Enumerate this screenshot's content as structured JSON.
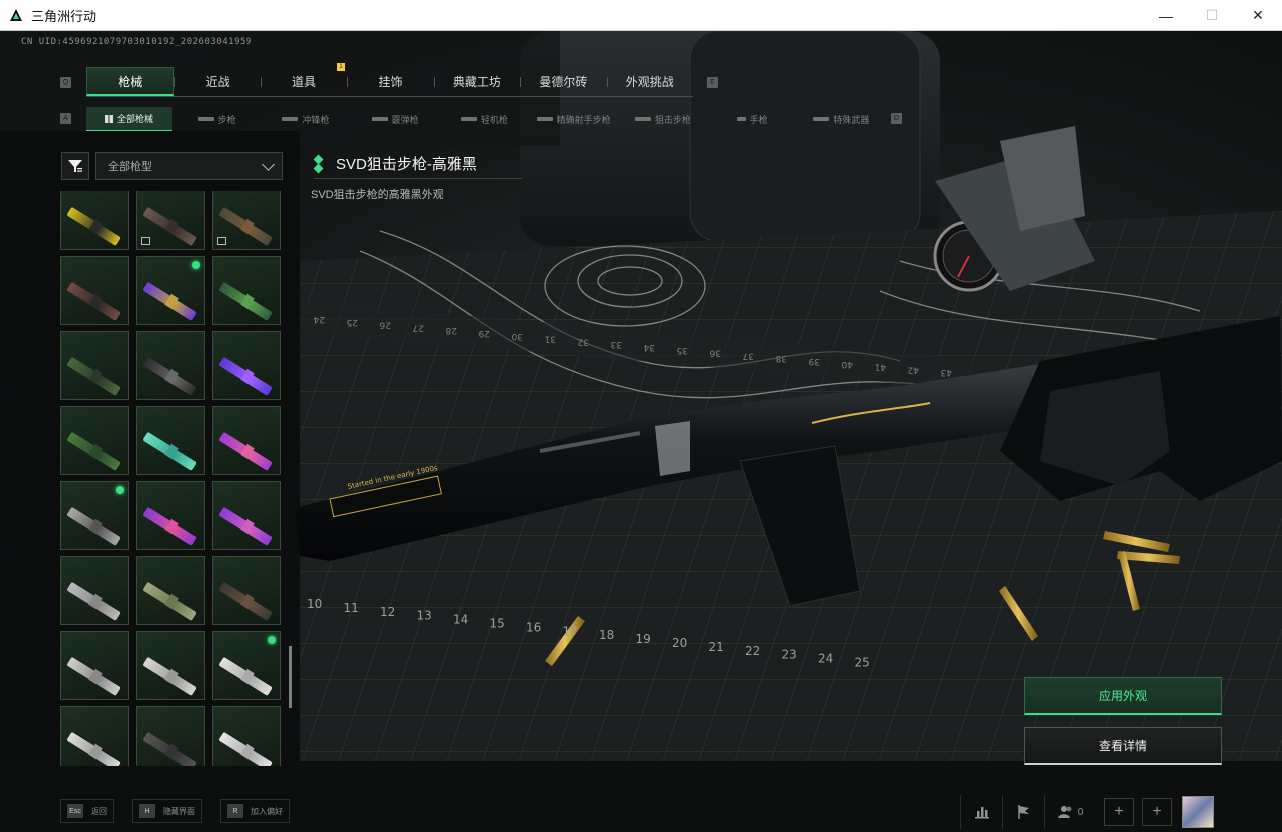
{
  "window": {
    "title": "三角洲行动",
    "minimize_glyph": "—",
    "maximize_glyph": "☐",
    "close_glyph": "✕"
  },
  "uid_text": "CN UID:4596921079703010192_202603041959",
  "main_tabs": [
    {
      "label": "枪械",
      "active": true
    },
    {
      "label": "近战"
    },
    {
      "label": "道具"
    },
    {
      "label": "挂饰"
    },
    {
      "label": "典藏工坊"
    },
    {
      "label": "曼德尔砖"
    },
    {
      "label": "外观挑战"
    }
  ],
  "main_tab_keys": {
    "left": "Q",
    "right": "E"
  },
  "notification_badge": "1",
  "sub_tabs": [
    {
      "label": "全部枪械",
      "active": true
    },
    {
      "label": "步枪"
    },
    {
      "label": "冲锋枪"
    },
    {
      "label": "霰弹枪"
    },
    {
      "label": "轻机枪"
    },
    {
      "label": "精确射手步枪"
    },
    {
      "label": "狙击步枪"
    },
    {
      "label": "手枪"
    },
    {
      "label": "特殊武器"
    }
  ],
  "sub_tab_keys": {
    "left": "A",
    "right": "D"
  },
  "filter": {
    "icon": "filter-icon",
    "dropdown_value": "全部枪型"
  },
  "skin": {
    "name": "SVD狙击步枪-高雅黑",
    "description": "SVD狙击步枪的高雅黑外观",
    "engraving": "Started in the early 1900s"
  },
  "grid_cells": [
    {
      "color": "#d8c21d",
      "accent": "#2a2a2a",
      "badge": false,
      "owned": false
    },
    {
      "color": "#6b5a52",
      "accent": "#3b2e2a",
      "badge": true,
      "owned": false
    },
    {
      "color": "#4a4a3a",
      "accent": "#7a5a3a",
      "badge": true,
      "owned": false
    },
    {
      "color": "#7a4a44",
      "accent": "#2a2a2a",
      "badge": false,
      "owned": false
    },
    {
      "color": "#6a3ad8",
      "accent": "#c0a040",
      "badge": false,
      "owned": true
    },
    {
      "color": "#2f5a3a",
      "accent": "#5aa050",
      "badge": false,
      "owned": false
    },
    {
      "color": "#4a6a3a",
      "accent": "#2a3a2a",
      "badge": false,
      "owned": false
    },
    {
      "color": "#2a2a2a",
      "accent": "#6a6a6a",
      "badge": false,
      "owned": false
    },
    {
      "color": "#5a3ad8",
      "accent": "#a060ff",
      "badge": false,
      "owned": false
    },
    {
      "color": "#4a7a3a",
      "accent": "#2a4a2a",
      "badge": false,
      "owned": false
    },
    {
      "color": "#6ae0c0",
      "accent": "#3aa090",
      "badge": false,
      "owned": false
    },
    {
      "color": "#a03ad0",
      "accent": "#e060a0",
      "badge": false,
      "owned": false
    },
    {
      "color": "#aaaaaa",
      "accent": "#555555",
      "badge": false,
      "owned": true
    },
    {
      "color": "#8a3ad0",
      "accent": "#e050a0",
      "badge": false,
      "owned": false
    },
    {
      "color": "#8a3ad8",
      "accent": "#d060c0",
      "badge": false,
      "owned": false
    },
    {
      "color": "#bbbbbb",
      "accent": "#888888",
      "badge": false,
      "owned": false
    },
    {
      "color": "#a0a880",
      "accent": "#6a7a50",
      "badge": false,
      "owned": false
    },
    {
      "color": "#3a3a30",
      "accent": "#6a5040",
      "badge": false,
      "owned": false
    },
    {
      "color": "#cfcfcf",
      "accent": "#888888",
      "badge": false,
      "owned": false
    },
    {
      "color": "#d8d8d8",
      "accent": "#999999",
      "badge": false,
      "owned": false
    },
    {
      "color": "#e0e0e0",
      "accent": "#aaaaaa",
      "badge": false,
      "owned": true
    },
    {
      "color": "#dddddd",
      "accent": "#999999",
      "badge": false,
      "owned": false
    },
    {
      "color": "#555555",
      "accent": "#333333",
      "badge": false,
      "owned": false
    },
    {
      "color": "#e6e6e6",
      "accent": "#aaaaaa",
      "badge": false,
      "owned": false
    }
  ],
  "buttons": {
    "apply": "应用外观",
    "details": "查看详情"
  },
  "bottom_hints": [
    {
      "key": "Esc",
      "label": "返回"
    },
    {
      "key": "H",
      "label": "隐藏界面"
    },
    {
      "key": "R",
      "label": "加入偏好"
    }
  ],
  "bottom_right": {
    "friends_count": "0",
    "plus_glyph": "+"
  },
  "ruler_numbers": [
    "10",
    "11",
    "12",
    "13",
    "14",
    "15",
    "16",
    "17",
    "18",
    "19",
    "20",
    "21",
    "22",
    "23",
    "24",
    "25"
  ],
  "ruler_top_numbers": [
    "24",
    "25",
    "26",
    "27",
    "28",
    "29",
    "30",
    "31",
    "32",
    "33",
    "34",
    "35",
    "36",
    "37",
    "38",
    "39",
    "40",
    "41",
    "42",
    "43"
  ]
}
